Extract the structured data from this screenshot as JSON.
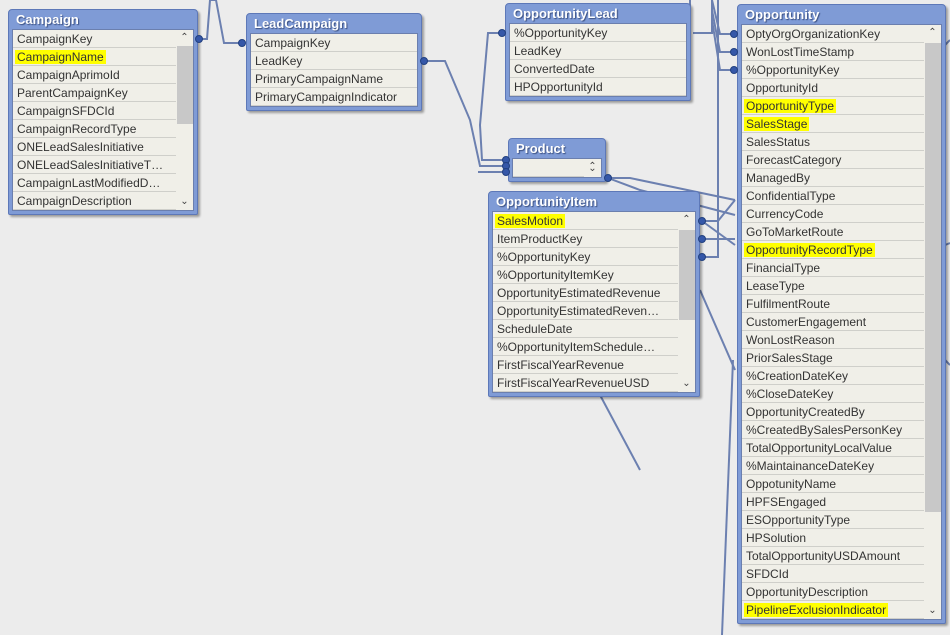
{
  "tables": [
    {
      "id": "campaign",
      "title": "Campaign",
      "scroll": {
        "from": 0.09,
        "to": 0.52
      },
      "fields": [
        {
          "name": "CampaignKey"
        },
        {
          "name": "CampaignName",
          "highlight": true
        },
        {
          "name": "CampaignAprimoId"
        },
        {
          "name": "ParentCampaignKey"
        },
        {
          "name": "CampaignSFDCId"
        },
        {
          "name": "CampaignRecordType"
        },
        {
          "name": "ONELeadSalesInitiative"
        },
        {
          "name": "ONELeadSalesInitiativeT…"
        },
        {
          "name": "CampaignLastModifiedD…"
        },
        {
          "name": "CampaignDescription"
        }
      ]
    },
    {
      "id": "leadcampaign",
      "title": "LeadCampaign",
      "fields": [
        {
          "name": "CampaignKey"
        },
        {
          "name": "LeadKey"
        },
        {
          "name": "PrimaryCampaignName"
        },
        {
          "name": "PrimaryCampaignIndicator"
        }
      ]
    },
    {
      "id": "opportunitylead",
      "title": "OpportunityLead",
      "fields": [
        {
          "name": "%OpportunityKey"
        },
        {
          "name": "LeadKey"
        },
        {
          "name": "ConvertedDate"
        },
        {
          "name": "HPOpportunityId"
        }
      ]
    },
    {
      "id": "product",
      "title": "Product",
      "fields": [
        {
          "name": ""
        }
      ],
      "scroll": {
        "from": 0,
        "to": 0
      }
    },
    {
      "id": "opportunityitem",
      "title": "OpportunityItem",
      "scroll": {
        "from": 0.1,
        "to": 0.6
      },
      "fields": [
        {
          "name": "SalesMotion",
          "highlight": true
        },
        {
          "name": "ItemProductKey"
        },
        {
          "name": "%OpportunityKey"
        },
        {
          "name": "%OpportunityItemKey"
        },
        {
          "name": "OpportunityEstimatedRevenue"
        },
        {
          "name": "OpportunityEstimatedReven…"
        },
        {
          "name": "ScheduleDate"
        },
        {
          "name": "%OpportunityItemSchedule…"
        },
        {
          "name": "FirstFiscalYearRevenue"
        },
        {
          "name": "FirstFiscalYearRevenueUSD"
        }
      ]
    },
    {
      "id": "opportunity",
      "title": "Opportunity",
      "scroll": {
        "from": 0.03,
        "to": 0.82
      },
      "fields": [
        {
          "name": "OptyOrgOrganizationKey"
        },
        {
          "name": "WonLostTimeStamp"
        },
        {
          "name": "%OpportunityKey"
        },
        {
          "name": "OpportunityId"
        },
        {
          "name": "OpportunityType",
          "highlight": true
        },
        {
          "name": "SalesStage",
          "highlight": true
        },
        {
          "name": "SalesStatus"
        },
        {
          "name": "ForecastCategory"
        },
        {
          "name": "ManagedBy"
        },
        {
          "name": "ConfidentialType"
        },
        {
          "name": "CurrencyCode"
        },
        {
          "name": "GoToMarketRoute"
        },
        {
          "name": "OpportunityRecordType",
          "highlight": true
        },
        {
          "name": "FinancialType"
        },
        {
          "name": "LeaseType"
        },
        {
          "name": "FulfilmentRoute"
        },
        {
          "name": "CustomerEngagement"
        },
        {
          "name": "WonLostReason"
        },
        {
          "name": "PriorSalesStage"
        },
        {
          "name": "%CreationDateKey"
        },
        {
          "name": "%CloseDateKey"
        },
        {
          "name": "OpportunityCreatedBy"
        },
        {
          "name": "%CreatedBySalesPersonKey"
        },
        {
          "name": "TotalOpportunityLocalValue"
        },
        {
          "name": "%MaintainanceDateKey"
        },
        {
          "name": "OppotunityName"
        },
        {
          "name": "HPFSEngaged"
        },
        {
          "name": "ESOpportunityType"
        },
        {
          "name": "HPSolution"
        },
        {
          "name": "TotalOpportunityUSDAmount"
        },
        {
          "name": "SFDCId"
        },
        {
          "name": "OpportunityDescription"
        },
        {
          "name": "PipelineExclusionIndicator",
          "highlight": true
        }
      ]
    }
  ],
  "colors": {
    "header": "#7f9bd6",
    "highlight": "#ffff00",
    "link": "#6c80b0",
    "background": "#ececec"
  }
}
